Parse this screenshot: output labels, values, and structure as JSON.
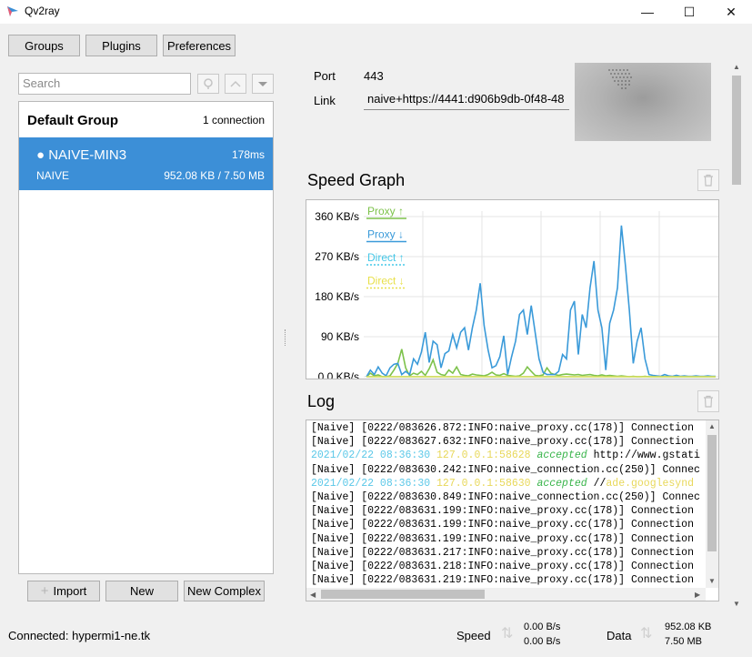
{
  "window": {
    "title": "Qv2ray",
    "minimize_glyph": "—",
    "maximize_glyph": "☐",
    "close_glyph": "✕"
  },
  "toolbar": {
    "groups_label": "Groups",
    "plugins_label": "Plugins",
    "preferences_label": "Preferences"
  },
  "search": {
    "placeholder": "Search"
  },
  "group": {
    "name": "Default Group",
    "count": "1 connection"
  },
  "connection": {
    "name": "● NAIVE-MIN3",
    "latency": "178ms",
    "type": "NAIVE",
    "data": "952.08 KB / 7.50 MB"
  },
  "details": {
    "port_label": "Port",
    "port_value": "443",
    "link_label": "Link",
    "link_value": "naive+https://4441:d906b9db-0f48-48"
  },
  "speed_graph": {
    "title": "Speed Graph"
  },
  "chart_data": {
    "type": "line",
    "ylim": [
      0,
      360
    ],
    "y_unit": "KB/s",
    "y_ticks": [
      "360 KB/s",
      "270 KB/s",
      "180 KB/s",
      "90 KB/s",
      "0.0 KB/s"
    ],
    "grid": true,
    "legend_position": "top-left",
    "series": [
      {
        "name": "Proxy ↑",
        "color": "#7dc24b",
        "values": [
          0,
          8,
          2,
          4,
          0,
          0,
          2,
          15,
          30,
          62,
          20,
          2,
          8,
          5,
          12,
          3,
          18,
          38,
          10,
          5,
          3,
          15,
          8,
          22,
          5,
          3,
          2,
          6,
          4,
          3,
          2,
          5,
          10,
          4,
          3,
          7,
          3,
          2,
          1,
          2,
          8,
          22,
          12,
          3,
          2,
          4,
          20,
          8,
          5,
          3,
          5,
          6,
          5,
          4,
          5,
          3,
          4,
          5,
          3,
          2,
          4,
          2,
          3,
          2,
          1,
          2,
          1,
          0,
          1,
          0,
          0,
          1,
          0,
          0,
          0,
          0,
          0,
          0,
          0,
          0,
          0,
          0,
          0,
          0,
          0,
          0,
          0,
          0,
          0,
          0
        ]
      },
      {
        "name": "Proxy ↓",
        "color": "#3a9ad9",
        "values": [
          0,
          15,
          5,
          22,
          8,
          2,
          20,
          28,
          30,
          5,
          12,
          5,
          40,
          28,
          55,
          100,
          32,
          80,
          72,
          20,
          52,
          58,
          95,
          65,
          100,
          110,
          60,
          110,
          150,
          210,
          115,
          60,
          20,
          25,
          45,
          92,
          5,
          45,
          80,
          140,
          150,
          95,
          160,
          100,
          40,
          10,
          5,
          5,
          5,
          12,
          50,
          40,
          150,
          170,
          50,
          140,
          110,
          200,
          260,
          150,
          110,
          15,
          120,
          150,
          200,
          340,
          250,
          150,
          30,
          80,
          110,
          40,
          5,
          3,
          2,
          1,
          5,
          2,
          1,
          3,
          1,
          2,
          1,
          1,
          2,
          1,
          1,
          2,
          1,
          1
        ]
      },
      {
        "name": "Direct ↑",
        "color": "#45c8e8",
        "values": [
          0,
          0,
          0,
          0,
          0,
          0,
          0,
          0,
          0,
          0,
          0,
          0,
          0,
          0,
          0,
          0,
          0,
          0,
          0,
          0,
          0,
          0,
          0,
          0,
          0,
          0,
          0,
          0,
          0,
          0,
          0,
          0,
          0,
          0,
          0,
          0,
          0,
          0,
          0,
          0,
          0,
          0,
          0,
          0,
          0,
          0,
          0,
          0,
          0,
          0,
          0,
          0,
          0,
          0,
          0,
          0,
          0,
          0,
          0,
          0,
          0,
          0,
          0,
          0,
          0,
          0,
          0,
          0,
          0,
          0,
          0,
          0,
          0,
          0,
          0,
          0,
          0,
          0,
          0,
          0,
          0,
          0,
          0,
          0,
          0,
          0,
          0,
          0,
          0,
          0
        ]
      },
      {
        "name": "Direct ↓",
        "color": "#e8e04a",
        "values": [
          0,
          0,
          0,
          0,
          0,
          0,
          0,
          0,
          0,
          0,
          0,
          0,
          0,
          0,
          0,
          0,
          0,
          0,
          0,
          0,
          0,
          0,
          0,
          0,
          0,
          0,
          0,
          0,
          0,
          0,
          0,
          0,
          0,
          0,
          0,
          0,
          0,
          0,
          0,
          0,
          0,
          0,
          0,
          0,
          0,
          0,
          0,
          0,
          0,
          0,
          0,
          0,
          0,
          0,
          0,
          0,
          0,
          0,
          0,
          0,
          0,
          0,
          0,
          0,
          0,
          0,
          0,
          0,
          0,
          0,
          0,
          0,
          0,
          0,
          0,
          0,
          0,
          0,
          0,
          0,
          0,
          0,
          0,
          0,
          0,
          0,
          0,
          0,
          0,
          0
        ]
      }
    ]
  },
  "log": {
    "title": "Log",
    "lines": [
      [
        {
          "t": "[Naive] [0222/083626.872:INFO:naive_proxy.cc(178)] Connection",
          "c": ""
        }
      ],
      [
        {
          "t": "[Naive] [0222/083627.632:INFO:naive_proxy.cc(178)] Connection",
          "c": ""
        }
      ],
      [
        {
          "t": "2021/02/22 08:36:30 ",
          "c": "log-ts"
        },
        {
          "t": "127.0.0.1:58628 ",
          "c": "log-host"
        },
        {
          "t": "accepted",
          "c": "log-acc"
        },
        {
          "t": " http://www.gstati",
          "c": ""
        }
      ],
      [
        {
          "t": "[Naive] [0222/083630.242:INFO:naive_connection.cc(250)] Connec",
          "c": ""
        }
      ],
      [
        {
          "t": "2021/02/22 08:36:30 ",
          "c": "log-ts"
        },
        {
          "t": "127.0.0.1:58630 ",
          "c": "log-host"
        },
        {
          "t": "accepted",
          "c": "log-acc"
        },
        {
          "t": " //",
          "c": ""
        },
        {
          "t": "ade.googlesynd",
          "c": "log-domain"
        }
      ],
      [
        {
          "t": "[Naive] [0222/083630.849:INFO:naive_connection.cc(250)] Connec",
          "c": ""
        }
      ],
      [
        {
          "t": "[Naive] [0222/083631.199:INFO:naive_proxy.cc(178)] Connection",
          "c": ""
        }
      ],
      [
        {
          "t": "[Naive] [0222/083631.199:INFO:naive_proxy.cc(178)] Connection",
          "c": ""
        }
      ],
      [
        {
          "t": "[Naive] [0222/083631.199:INFO:naive_proxy.cc(178)] Connection",
          "c": ""
        }
      ],
      [
        {
          "t": "[Naive] [0222/083631.217:INFO:naive_proxy.cc(178)] Connection",
          "c": ""
        }
      ],
      [
        {
          "t": "[Naive] [0222/083631.218:INFO:naive_proxy.cc(178)] Connection",
          "c": ""
        }
      ],
      [
        {
          "t": "[Naive] [0222/083631.219:INFO:naive_proxy.cc(178)] Connection",
          "c": ""
        }
      ]
    ]
  },
  "actions": {
    "import_label": "Import",
    "new_label": "New",
    "new_complex_label": "New Complex"
  },
  "status": {
    "connected": "Connected: hypermi1-ne.tk",
    "speed_label": "Speed",
    "speed_up": "0.00 B/s",
    "speed_down": "0.00 B/s",
    "data_label": "Data",
    "data_up": "952.08 KB",
    "data_down": "7.50 MB"
  },
  "colors": {
    "selection": "#3c8fd7",
    "proxy_up": "#7dc24b",
    "proxy_down": "#3a9ad9",
    "direct_up": "#45c8e8",
    "direct_down": "#e8e04a"
  }
}
